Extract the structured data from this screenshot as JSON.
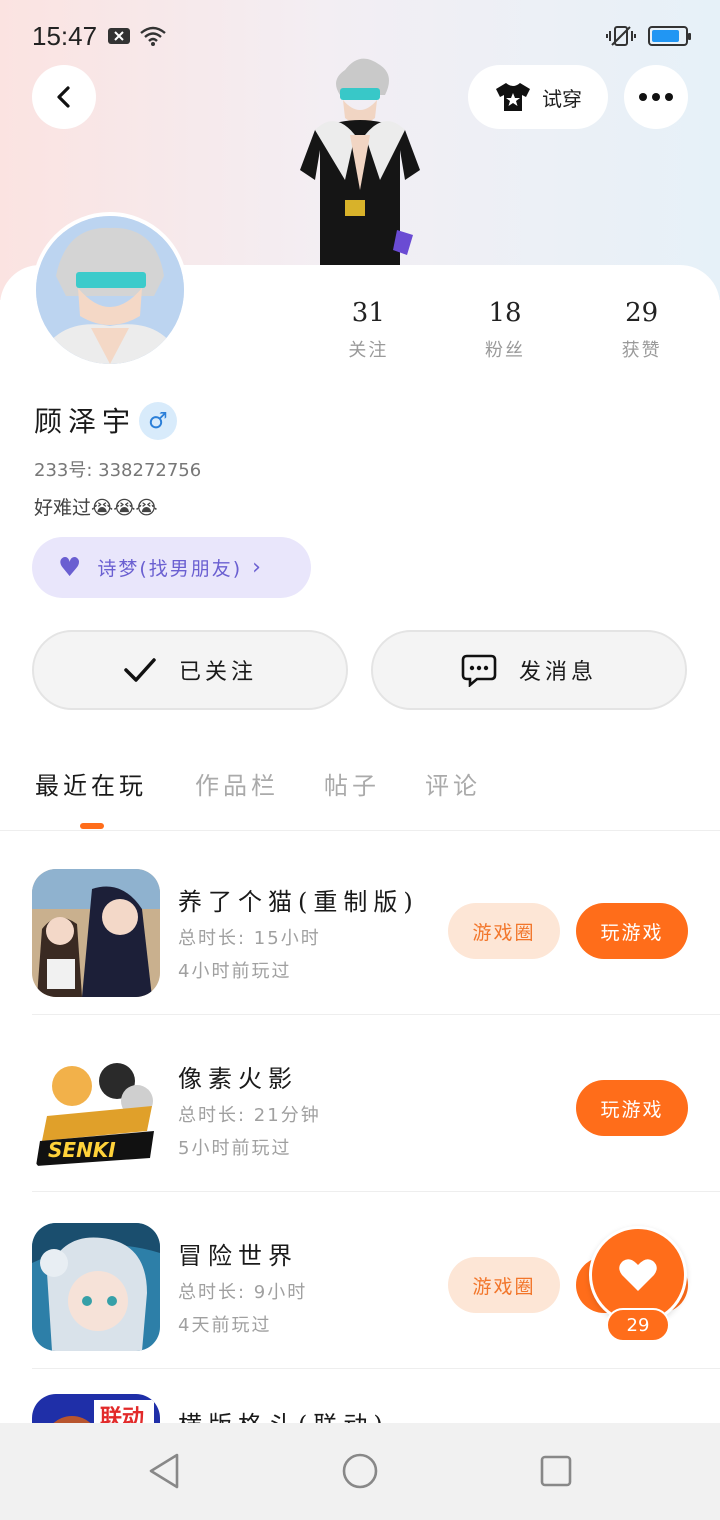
{
  "status_bar": {
    "time": "15:47",
    "battery_level": 0.85
  },
  "header": {
    "tryon_label": "试穿"
  },
  "profile": {
    "name": "顾泽宇",
    "gender_symbol": "♂",
    "uid": "233号: 338272756",
    "bio": "好难过😭😭😭",
    "tag": "诗梦(找男朋友)",
    "stats": [
      {
        "value": "31",
        "label": "关注"
      },
      {
        "value": "18",
        "label": "粉丝"
      },
      {
        "value": "29",
        "label": "获赞"
      }
    ]
  },
  "actions": {
    "follow_label": "已关注",
    "message_label": "发消息"
  },
  "tabs": [
    {
      "label": "最近在玩",
      "active": true
    },
    {
      "label": "作品栏",
      "active": false
    },
    {
      "label": "帖子",
      "active": false
    },
    {
      "label": "评论",
      "active": false
    }
  ],
  "games": [
    {
      "title": "养了个猫(重制版)",
      "playtime": "总时长: 15小时",
      "last_played": "4小时前玩过",
      "circle_label": "游戏圈",
      "play_label": "玩游戏"
    },
    {
      "title": "像素火影",
      "playtime": "总时长: 21分钟",
      "last_played": "5小时前玩过",
      "play_label": "玩游戏"
    },
    {
      "title": "冒险世界",
      "playtime": "总时长: 9小时",
      "last_played": "4天前玩过",
      "circle_label": "游戏圈",
      "play_label": "玩游戏"
    },
    {
      "title": "横版格斗(联动)",
      "icon_label": "联动"
    }
  ],
  "floating_like": {
    "count": "29"
  },
  "colors": {
    "accent": "#ff6d1a",
    "tag_bg": "#e9e6fb",
    "tag_text": "#6a5fd1"
  }
}
